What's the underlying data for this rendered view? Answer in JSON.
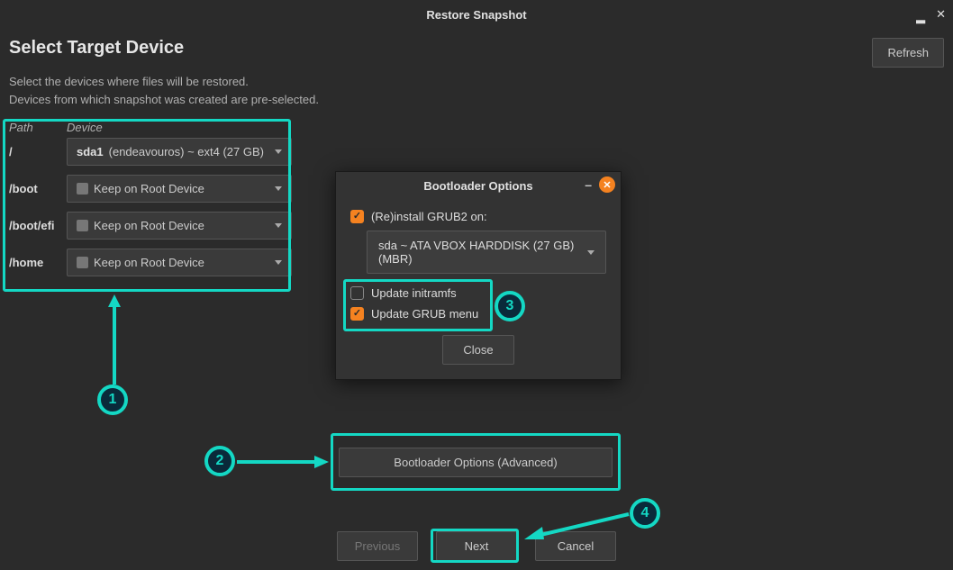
{
  "window": {
    "title": "Restore Snapshot"
  },
  "header": {
    "page_title": "Select Target Device",
    "refresh": "Refresh"
  },
  "description": {
    "line1": "Select the devices where files will be restored.",
    "line2": "Devices from which snapshot was created are pre-selected."
  },
  "table": {
    "col_path": "Path",
    "col_device": "Device",
    "rows": [
      {
        "path": "/",
        "device_bold": "sda1",
        "device_rest": " (endeavouros) ~ ext4 (27 GB)",
        "has_icon": false
      },
      {
        "path": "/boot",
        "device_bold": "",
        "device_rest": "Keep on Root Device",
        "has_icon": true
      },
      {
        "path": "/boot/efi",
        "device_bold": "",
        "device_rest": "Keep on Root Device",
        "has_icon": true
      },
      {
        "path": "/home",
        "device_bold": "",
        "device_rest": "Keep on Root Device",
        "has_icon": true
      }
    ]
  },
  "dialog": {
    "title": "Bootloader Options",
    "reinstall_label": "(Re)install GRUB2 on:",
    "reinstall_checked": true,
    "grub_target": "sda ~ ATA VBOX HARDDISK (27 GB) (MBR)",
    "update_initramfs_label": "Update initramfs",
    "update_initramfs_checked": false,
    "update_grubmenu_label": "Update GRUB menu",
    "update_grubmenu_checked": true,
    "close": "Close"
  },
  "bootloader_button": "Bootloader Options (Advanced)",
  "nav": {
    "previous": "Previous",
    "next": "Next",
    "cancel": "Cancel"
  },
  "annotations": {
    "n1": "1",
    "n2": "2",
    "n3": "3",
    "n4": "4"
  }
}
